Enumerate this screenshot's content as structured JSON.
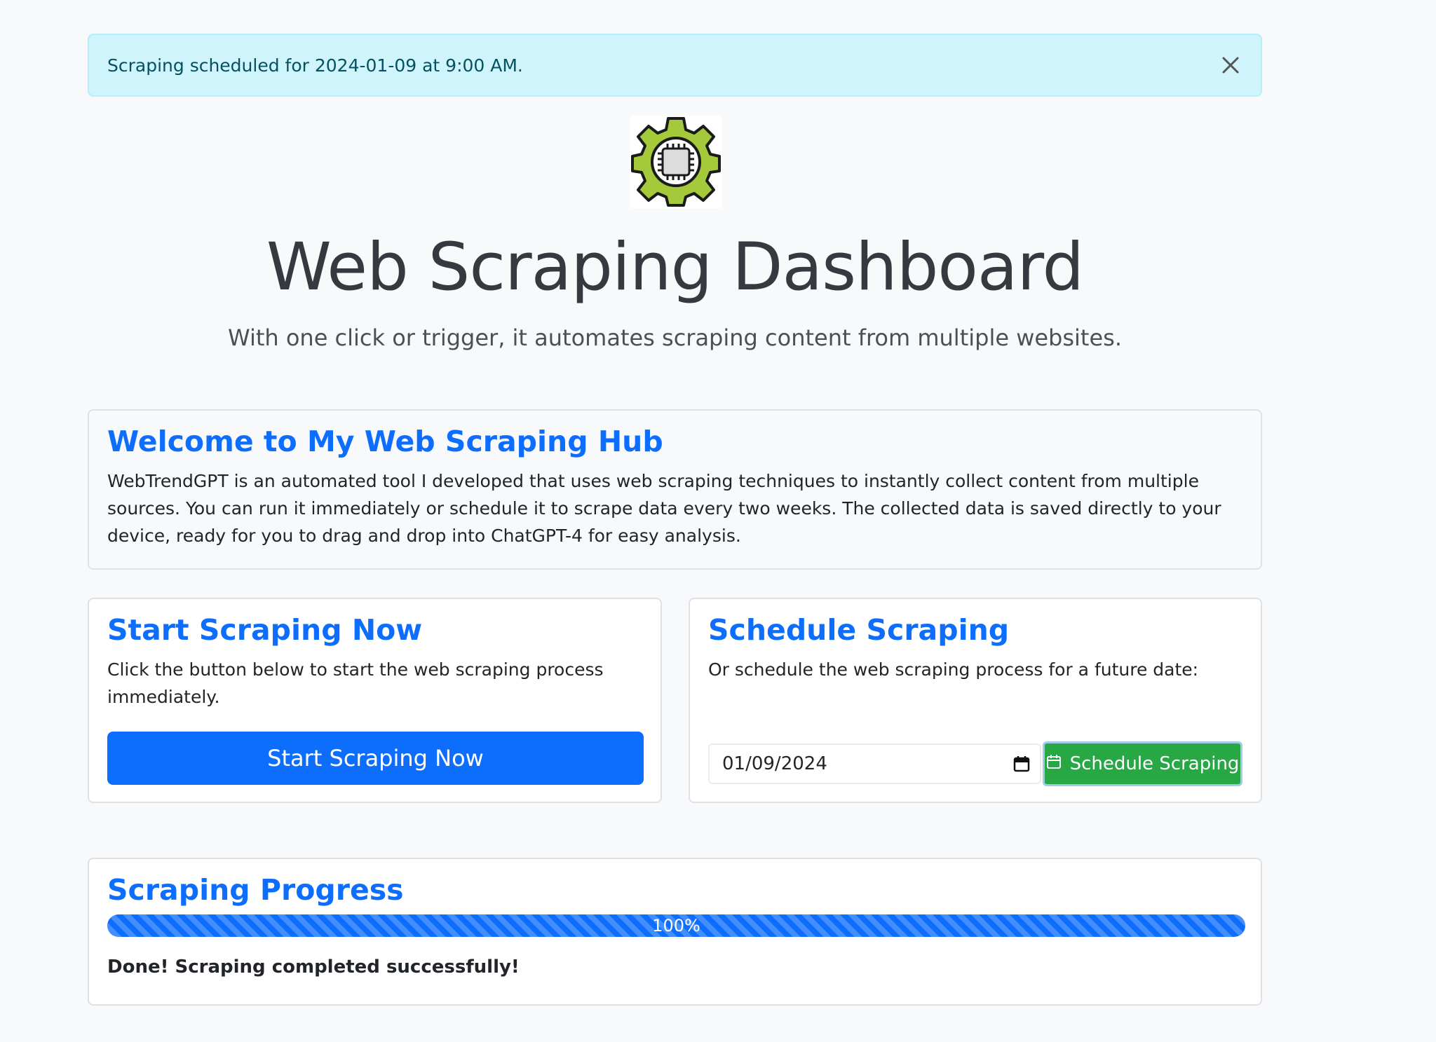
{
  "alert": {
    "message": "Scraping scheduled for 2024-01-09 at 9:00 AM.",
    "close_icon": "close-icon"
  },
  "logo": {
    "icon": "gear-chip-icon",
    "colors": {
      "gear": "#a4c93a",
      "outline": "#1b1b1b",
      "chip": "#dcdcdc"
    }
  },
  "header": {
    "title": "Web Scraping Dashboard",
    "subtitle": "With one click or trigger, it automates scraping content from multiple websites."
  },
  "welcome": {
    "title": "Welcome to My Web Scraping Hub",
    "body": "WebTrendGPT is an automated tool I developed that uses web scraping techniques to instantly collect content from multiple sources. You can run it immediately or schedule it to scrape data every two weeks. The collected data is saved directly to your device, ready for you to drag and drop into ChatGPT-4 for easy analysis."
  },
  "start": {
    "title": "Start Scraping Now",
    "description": "Click the button below to start the web scraping process immediately.",
    "button_label": "Start Scraping Now"
  },
  "schedule": {
    "title": "Schedule Scraping",
    "description": "Or schedule the web scraping process for a future date:",
    "date_value": "01/09/2024",
    "date_icon": "calendar-icon",
    "button_label": "Schedule Scraping",
    "button_icon": "calendar-icon"
  },
  "progress": {
    "title": "Scraping Progress",
    "percent": 100,
    "percent_label": "100%",
    "status": "Done! Scraping completed successfully!"
  },
  "colors": {
    "primary": "#0d6efd",
    "success": "#28a745",
    "alert_bg": "#cff4fc",
    "alert_text": "#055160",
    "page_bg": "#f8f9fa"
  }
}
